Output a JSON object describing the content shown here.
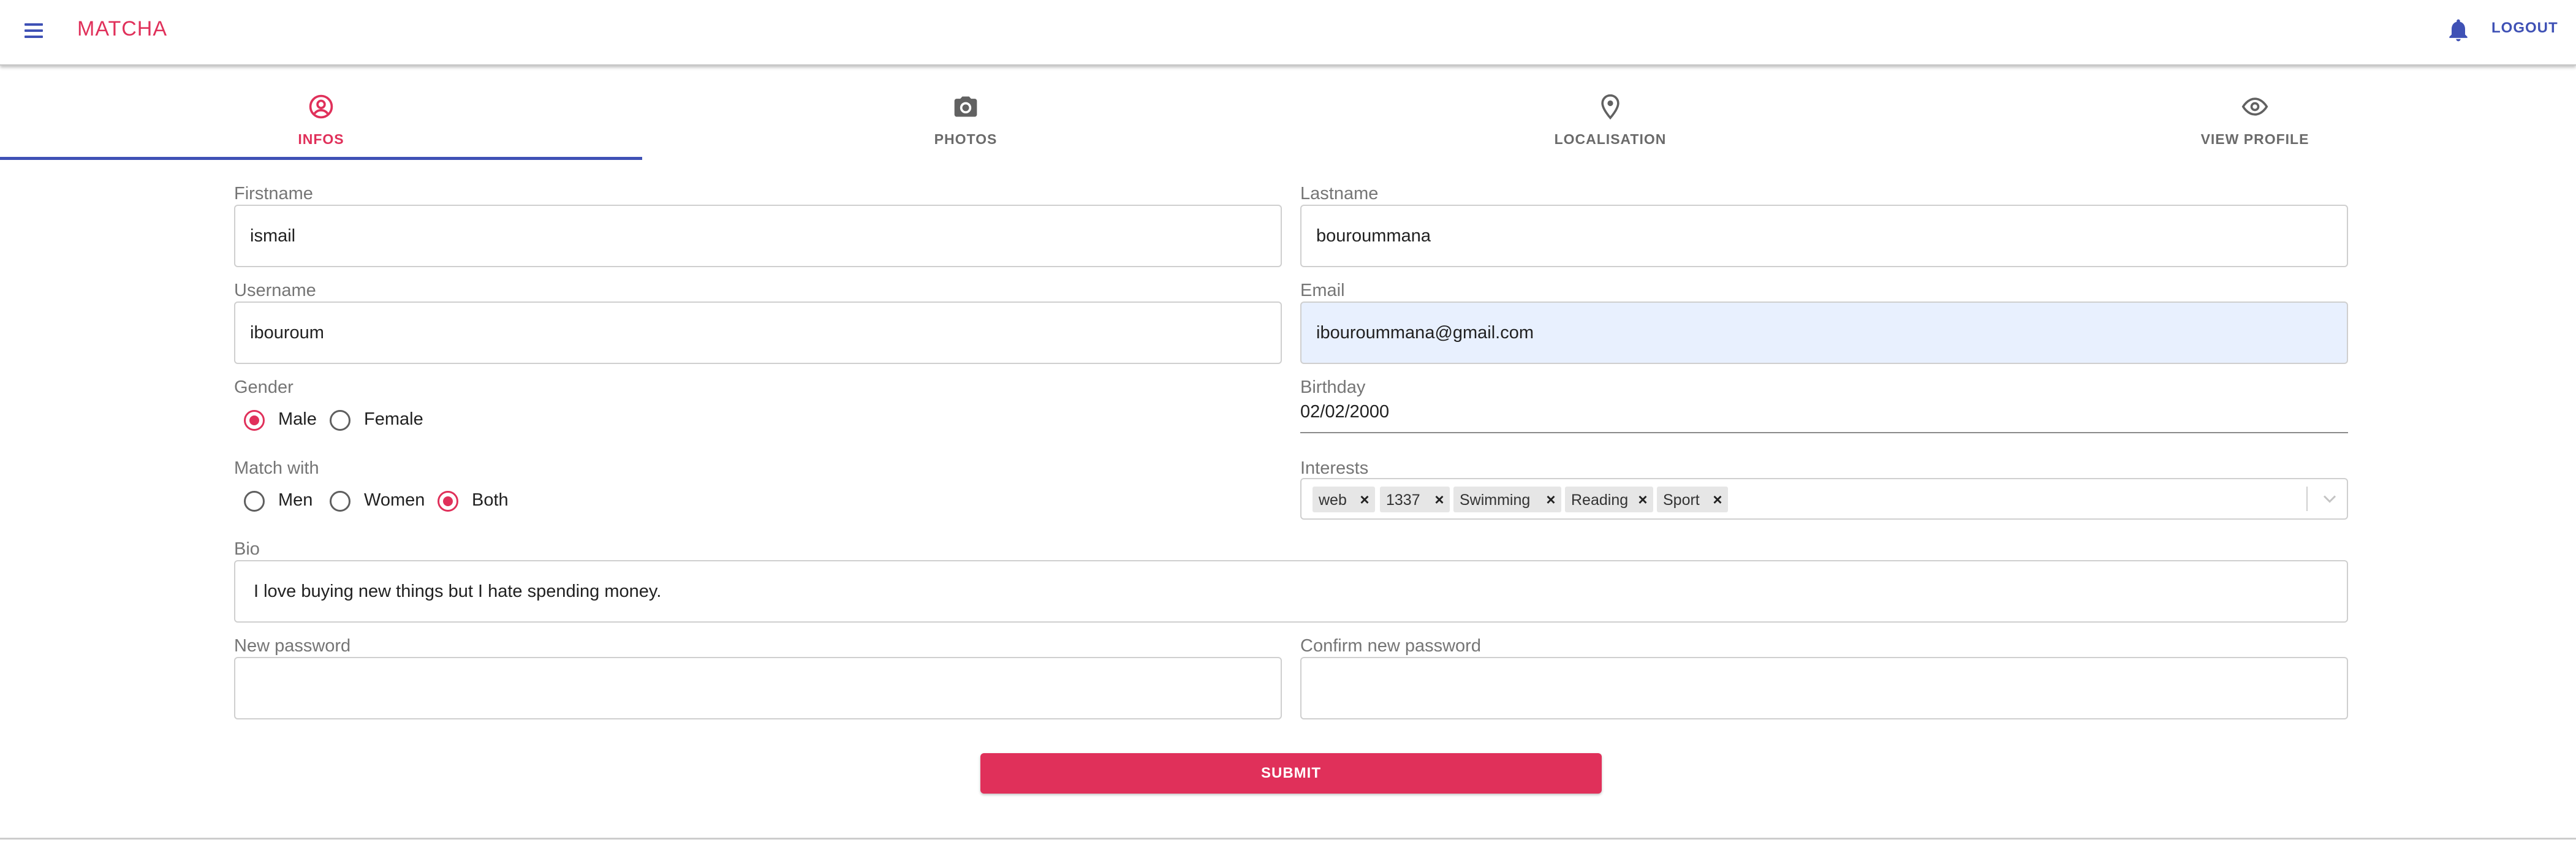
{
  "app": {
    "brand": "MATCHA",
    "logout_label": "LOGOUT"
  },
  "icons": {
    "menu": "menu-icon",
    "notifications": "bell-icon",
    "infos": "account-circle-icon",
    "photos": "camera-icon",
    "localisation": "location-pin-icon",
    "view_profile": "eye-icon",
    "chip_remove": "close-icon",
    "select_open": "chevron-down-icon"
  },
  "colors": {
    "accent": "#e0305a",
    "primary": "#3f51b5",
    "autofill": "#e8f0fe"
  },
  "tabs": [
    {
      "label": "INFOS",
      "active": true
    },
    {
      "label": "PHOTOS",
      "active": false
    },
    {
      "label": "LOCALISATION",
      "active": false
    },
    {
      "label": "VIEW PROFILE",
      "active": false
    }
  ],
  "form": {
    "firstname": {
      "label": "Firstname",
      "value": "ismail"
    },
    "lastname": {
      "label": "Lastname",
      "value": "bouroummana"
    },
    "username": {
      "label": "Username",
      "value": "ibouroum"
    },
    "email": {
      "label": "Email",
      "value": "ibouroummana@gmail.com"
    },
    "gender": {
      "label": "Gender",
      "options": [
        {
          "label": "Male",
          "checked": true
        },
        {
          "label": "Female",
          "checked": false
        }
      ]
    },
    "birthday": {
      "label": "Birthday",
      "value": "02/02/2000"
    },
    "match_with": {
      "label": "Match with",
      "options": [
        {
          "label": "Men",
          "checked": false
        },
        {
          "label": "Women",
          "checked": false
        },
        {
          "label": "Both",
          "checked": true
        }
      ]
    },
    "interests": {
      "label": "Interests",
      "chips": [
        "web",
        "1337",
        "Swimming",
        "Reading",
        "Sport"
      ],
      "remove_glyph": "×"
    },
    "bio": {
      "label": "Bio",
      "value": "I love buying new things but I hate spending money."
    },
    "new_password": {
      "label": "New password",
      "value": ""
    },
    "confirm_password": {
      "label": "Confirm new password",
      "value": ""
    },
    "submit_label": "SUBMIT"
  }
}
